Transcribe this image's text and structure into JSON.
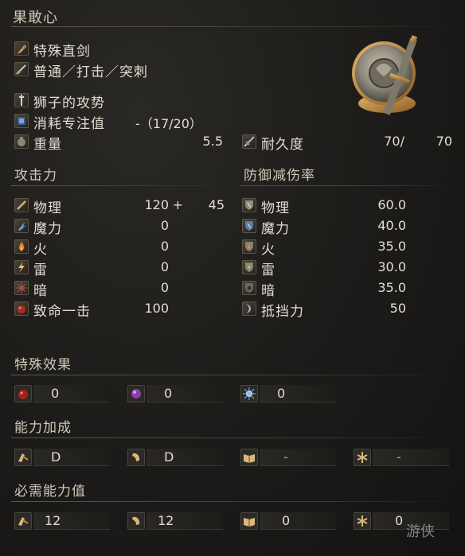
{
  "weapon": {
    "name": "果敢心",
    "type": "特殊直剑",
    "attack_type": "普通／打击／突刺",
    "skill": "狮子的攻势",
    "fp_cost_label": "消耗专注值",
    "fp_cost_value": "-（17/20）",
    "weight_label": "重量",
    "weight_value": "5.5",
    "durability_label": "耐久度",
    "durability_current": "70/",
    "durability_max": "70"
  },
  "attack": {
    "header": "攻击力",
    "rows": [
      {
        "label": "物理",
        "value": "120",
        "bonus": "+",
        "bonus_value": "45",
        "icon": "sword-icon"
      },
      {
        "label": "魔力",
        "value": "0",
        "icon": "magic-icon"
      },
      {
        "label": "火",
        "value": "0",
        "icon": "fire-icon"
      },
      {
        "label": "雷",
        "value": "0",
        "icon": "lightning-icon"
      },
      {
        "label": "暗",
        "value": "0",
        "icon": "dark-icon"
      },
      {
        "label": "致命一击",
        "value": "100",
        "icon": "critical-icon"
      }
    ]
  },
  "defense": {
    "header": "防御减伤率",
    "rows": [
      {
        "label": "物理",
        "value": "60.0",
        "icon": "shield-physical-icon"
      },
      {
        "label": "魔力",
        "value": "40.0",
        "icon": "shield-magic-icon"
      },
      {
        "label": "火",
        "value": "35.0",
        "icon": "shield-fire-icon"
      },
      {
        "label": "雷",
        "value": "30.0",
        "icon": "shield-lightning-icon"
      },
      {
        "label": "暗",
        "value": "35.0",
        "icon": "shield-dark-icon"
      },
      {
        "label": "抵挡力",
        "value": "50",
        "icon": "stability-icon"
      }
    ]
  },
  "effects": {
    "header": "特殊效果",
    "items": [
      {
        "icon": "bleed-icon",
        "value": "0"
      },
      {
        "icon": "poison-icon",
        "value": "0"
      },
      {
        "icon": "frost-icon",
        "value": "0"
      }
    ]
  },
  "scaling": {
    "header": "能力加成",
    "items": [
      {
        "icon": "strength-icon",
        "value": "D"
      },
      {
        "icon": "dexterity-icon",
        "value": "D"
      },
      {
        "icon": "intelligence-icon",
        "value": "-"
      },
      {
        "icon": "faith-icon",
        "value": "-"
      }
    ]
  },
  "requirements": {
    "header": "必需能力值",
    "items": [
      {
        "icon": "strength-icon",
        "value": "12"
      },
      {
        "icon": "dexterity-icon",
        "value": "12"
      },
      {
        "icon": "intelligence-icon",
        "value": "0"
      },
      {
        "icon": "faith-icon",
        "value": "0"
      }
    ]
  },
  "watermark": "游侠"
}
